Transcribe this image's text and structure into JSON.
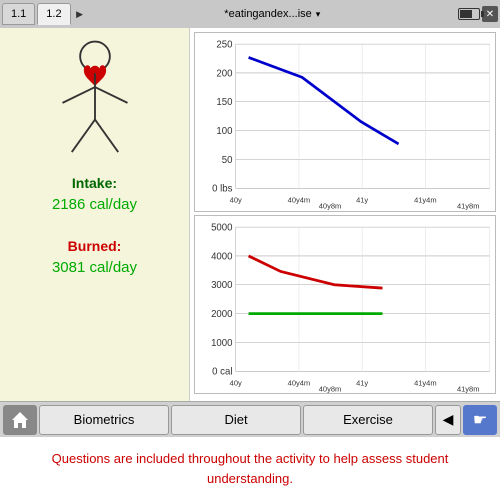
{
  "tabs": [
    {
      "id": "1.1",
      "label": "1.1",
      "active": false
    },
    {
      "id": "1.2",
      "label": "1.2",
      "active": true
    }
  ],
  "title": {
    "text": "*eatingandex...ise",
    "arrow": "▾"
  },
  "left_panel": {
    "intake_label": "Intake:",
    "intake_value": "2186 cal/day",
    "burned_label": "Burned:",
    "burned_value": "3081 cal/day"
  },
  "charts": {
    "top": {
      "y_labels": [
        "250",
        "200",
        "150",
        "100",
        "50",
        "0 lbs"
      ],
      "x_labels": [
        "40y",
        "40y4m40y8m",
        "41y",
        "41y4m41y8m"
      ]
    },
    "bottom": {
      "y_labels": [
        "5000",
        "4000",
        "3000",
        "2000",
        "1000",
        "0 cal"
      ],
      "x_labels": [
        "40y",
        "40y4m40y8m",
        "41y",
        "41y4m41y8m"
      ]
    }
  },
  "nav": {
    "home_icon": "🏠",
    "biometrics": "Biometrics",
    "diet": "Diet",
    "exercise": "Exercise",
    "back_arrow": "◀",
    "cursor_icon": "☛"
  },
  "footer": {
    "text": "Questions are included throughout the activity to help assess student understanding."
  }
}
